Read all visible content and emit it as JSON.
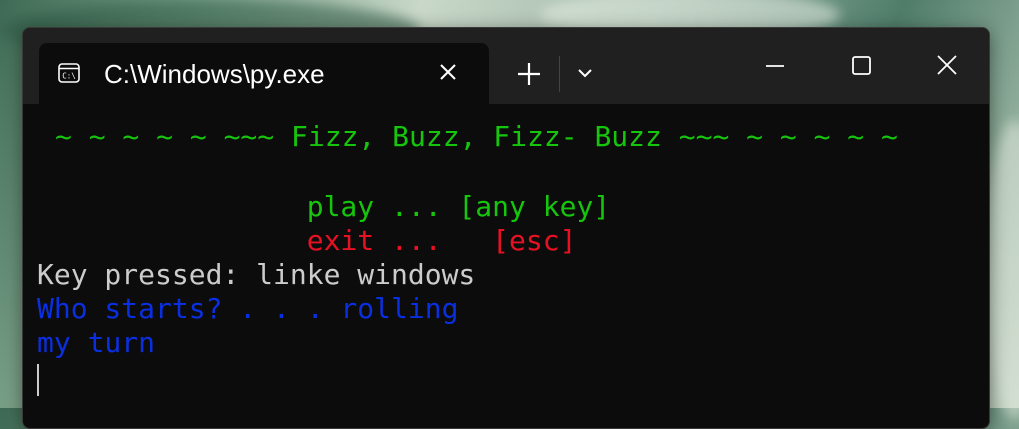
{
  "window": {
    "tab_title": "C:\\Windows\\py.exe",
    "icons": {
      "tab": "console-icon",
      "close_tab": "close-icon",
      "new_tab": "plus-icon",
      "dropdown": "chevron-down-icon",
      "minimize": "minimize-icon",
      "maximize": "maximize-icon",
      "close_window": "close-icon"
    }
  },
  "console": {
    "banner": "~ ~ ~ ~ ~ ~~~ Fizz, Buzz, Fizz- Buzz ~~~ ~ ~ ~ ~ ~",
    "menu_play": "                play ... [any key]",
    "menu_exit": "                exit ...   [esc]",
    "key_pressed": "Key pressed: linke windows",
    "who_starts": "Who starts? . . . rolling",
    "turn": "my turn",
    "colors": {
      "green": "#16c60c",
      "red": "#e81123",
      "gray": "#cccccc",
      "blue": "#0a2fe0",
      "background": "#0c0c0c"
    }
  }
}
